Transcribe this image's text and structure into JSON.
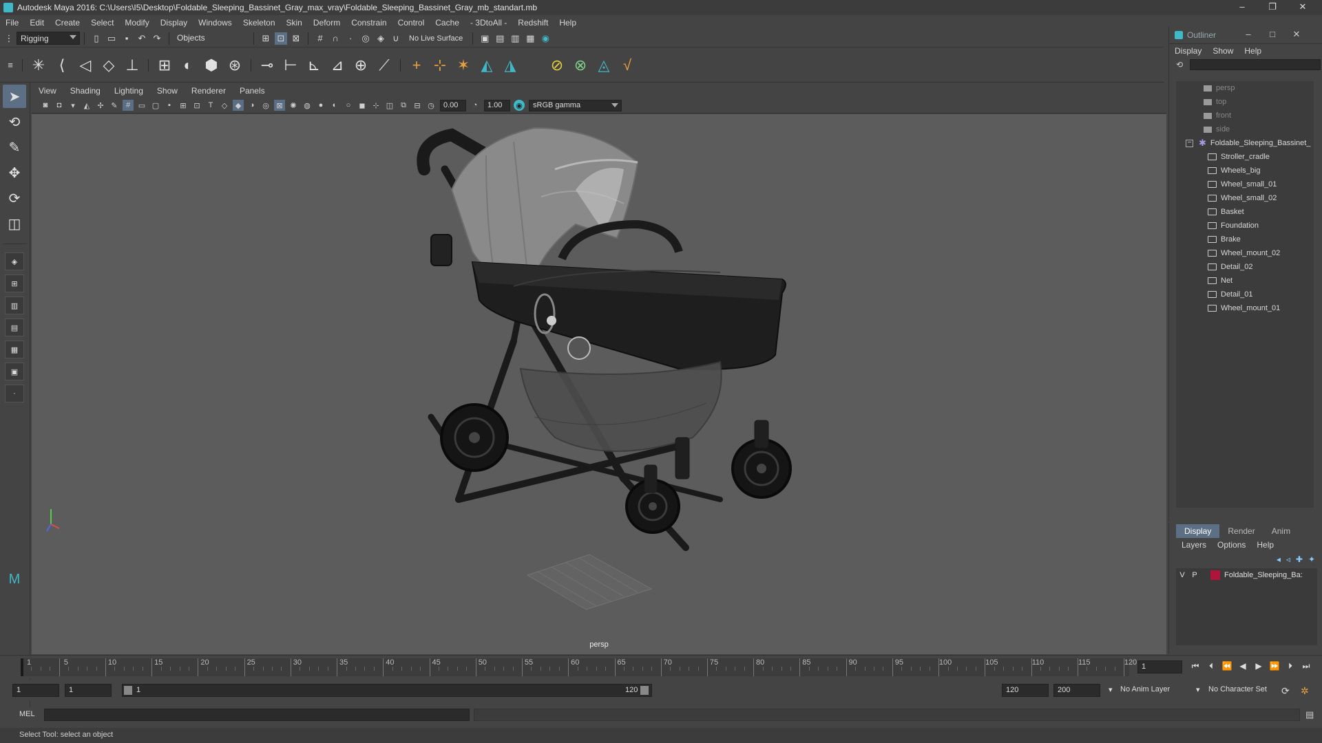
{
  "window": {
    "title": "Autodesk Maya 2016: C:\\Users\\I5\\Desktop\\Foldable_Sleeping_Bassinet_Gray_max_vray\\Foldable_Sleeping_Bassinet_Gray_mb_standart.mb",
    "minimize": "–",
    "restore": "❐",
    "close": "✕"
  },
  "menubar": [
    "File",
    "Edit",
    "Create",
    "Select",
    "Modify",
    "Display",
    "Windows",
    "Skeleton",
    "Skin",
    "Deform",
    "Constrain",
    "Control",
    "Cache",
    "- 3DtoAll -",
    "Redshift",
    "Help"
  ],
  "statusline": {
    "mode": "Rigging",
    "selection_mode": "Objects",
    "live_surface": "No Live Surface"
  },
  "panel": {
    "menu": [
      "View",
      "Shading",
      "Lighting",
      "Show",
      "Renderer",
      "Panels"
    ],
    "exposure": "0.00",
    "gamma_value": "1.00",
    "color_space": "sRGB gamma",
    "camera_label": "persp"
  },
  "outliner": {
    "title": "Outliner",
    "menu": [
      "Display",
      "Show",
      "Help"
    ],
    "cameras": [
      "persp",
      "top",
      "front",
      "side"
    ],
    "group": "Foldable_Sleeping_Bassinet_",
    "children": [
      "Stroller_cradle",
      "Wheels_big",
      "Wheel_small_01",
      "Wheel_small_02",
      "Basket",
      "Foundation",
      "Brake",
      "Wheel_mount_02",
      "Detail_02",
      "Net",
      "Detail_01",
      "Wheel_mount_01"
    ]
  },
  "layer_editor": {
    "tabs": [
      "Display",
      "Render",
      "Anim"
    ],
    "menu": [
      "Layers",
      "Options",
      "Help"
    ],
    "layer": {
      "v": "V",
      "p": "P",
      "name": "Foldable_Sleeping_Ba:",
      "color": "#b0143a"
    }
  },
  "timeline": {
    "ticks": [
      "1",
      "5",
      "10",
      "15",
      "20",
      "25",
      "30",
      "35",
      "40",
      "45",
      "50",
      "55",
      "60",
      "65",
      "70",
      "75",
      "80",
      "85",
      "90",
      "95",
      "100",
      "105",
      "110",
      "115",
      "120"
    ],
    "current_frame": "1"
  },
  "range": {
    "start": "1",
    "inner_start": "1",
    "slider_start": "1",
    "slider_end": "120",
    "end": "120",
    "anim_end": "200",
    "anim_layer": "No Anim Layer",
    "character_set": "No Character Set"
  },
  "command": {
    "lang": "MEL"
  },
  "help_line": "Select Tool: select an object"
}
